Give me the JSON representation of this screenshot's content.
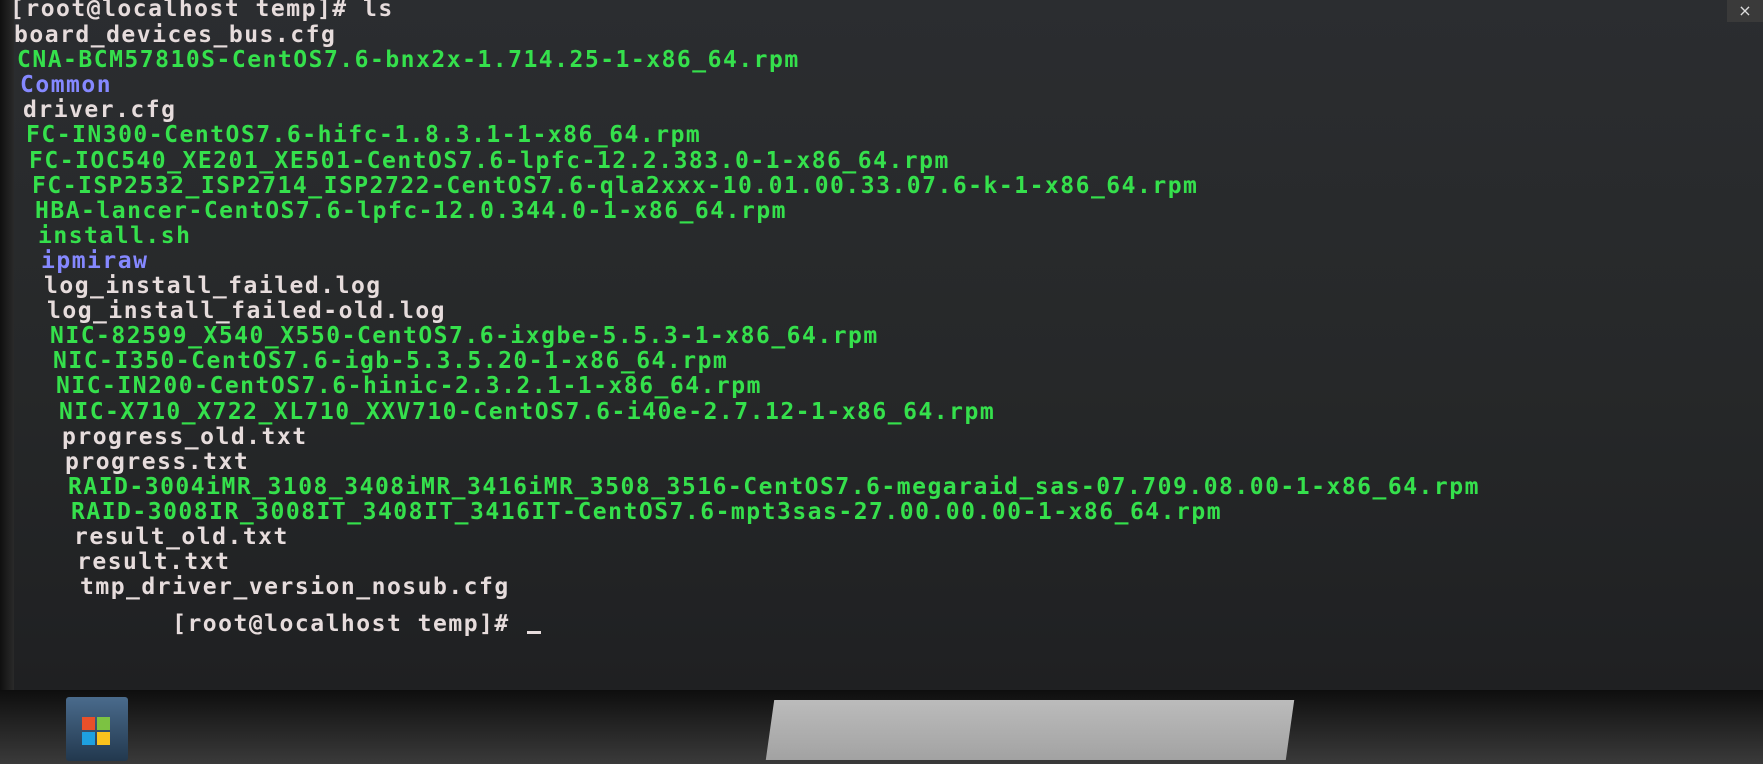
{
  "window": {
    "close_label": "×"
  },
  "terminal": {
    "command_line": "[root@localhost temp]# ls",
    "files": [
      {
        "name": "board_devices_bus.cfg",
        "color": "#e6dcdc"
      },
      {
        "name": "CNA-BCM57810S-CentOS7.6-bnx2x-1.714.25-1-x86_64.rpm",
        "color": "#35e04c"
      },
      {
        "name": "Common",
        "color": "#8588ff"
      },
      {
        "name": "driver.cfg",
        "color": "#e6dcdc"
      },
      {
        "name": "FC-IN300-CentOS7.6-hifc-1.8.3.1-1-x86_64.rpm",
        "color": "#35e04c"
      },
      {
        "name": "FC-IOC540_XE201_XE501-CentOS7.6-lpfc-12.2.383.0-1-x86_64.rpm",
        "color": "#35e04c"
      },
      {
        "name": "FC-ISP2532_ISP2714_ISP2722-CentOS7.6-qla2xxx-10.01.00.33.07.6-k-1-x86_64.rpm",
        "color": "#35e04c"
      },
      {
        "name": "HBA-lancer-CentOS7.6-lpfc-12.0.344.0-1-x86_64.rpm",
        "color": "#35e04c"
      },
      {
        "name": "install.sh",
        "color": "#35e04c"
      },
      {
        "name": "ipmiraw",
        "color": "#8588ff"
      },
      {
        "name": "log_install_failed.log",
        "color": "#e6dcdc"
      },
      {
        "name": "log_install_failed-old.log",
        "color": "#e6dcdc"
      },
      {
        "name": "NIC-82599_X540_X550-CentOS7.6-ixgbe-5.5.3-1-x86_64.rpm",
        "color": "#35e04c"
      },
      {
        "name": "NIC-I350-CentOS7.6-igb-5.3.5.20-1-x86_64.rpm",
        "color": "#35e04c"
      },
      {
        "name": "NIC-IN200-CentOS7.6-hinic-2.3.2.1-1-x86_64.rpm",
        "color": "#35e04c"
      },
      {
        "name": "NIC-X710_X722_XL710_XXV710-CentOS7.6-i40e-2.7.12-1-x86_64.rpm",
        "color": "#35e04c"
      },
      {
        "name": "progress_old.txt",
        "color": "#e6dcdc"
      },
      {
        "name": "progress.txt",
        "color": "#e6dcdc"
      },
      {
        "name": "RAID-3004iMR_3108_3408iMR_3416iMR_3508_3516-CentOS7.6-megaraid_sas-07.709.08.00-1-x86_64.rpm",
        "color": "#35e04c"
      },
      {
        "name": "RAID-3008IR_3008IT_3408IT_3416IT-CentOS7.6-mpt3sas-27.00.00.00-1-x86_64.rpm",
        "color": "#35e04c"
      },
      {
        "name": "result_old.txt",
        "color": "#e6dcdc"
      },
      {
        "name": "result.txt",
        "color": "#e6dcdc"
      },
      {
        "name": "tmp_driver_version_nosub.cfg",
        "color": "#e6dcdc"
      }
    ],
    "prompt": "[root@localhost temp]# "
  },
  "bezel": {
    "badge_icon": "windows-logo-icon"
  }
}
